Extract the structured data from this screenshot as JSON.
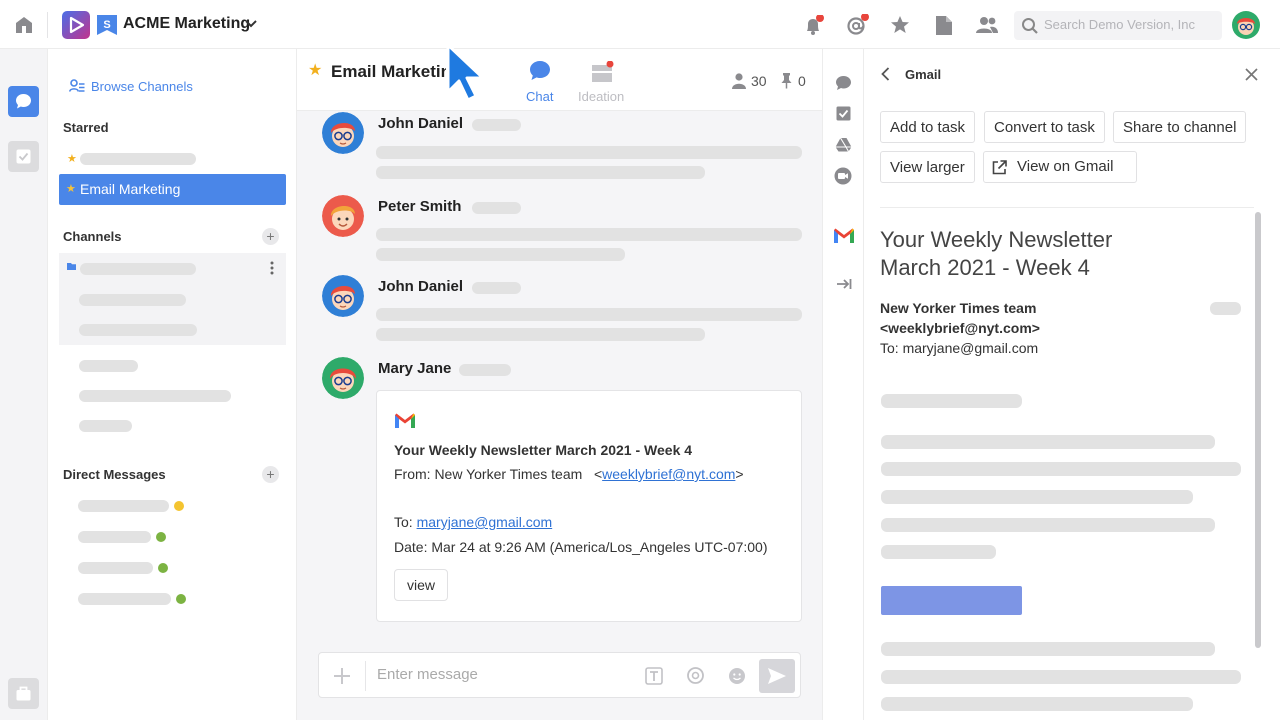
{
  "topbar": {
    "workspace_name": "ACME Marketing",
    "search_placeholder": "Search Demo Version, Inc"
  },
  "sidebar": {
    "browse_channels": "Browse Channels",
    "starred_heading": "Starred",
    "active_channel": "Email Marketing",
    "channels_heading": "Channels",
    "dm_heading": "Direct Messages"
  },
  "chat": {
    "channel_title": "Email Marketing",
    "tabs": [
      {
        "label": "Chat",
        "active": true
      },
      {
        "label": "Ideation",
        "active": false
      }
    ],
    "member_count": "30",
    "pin_count": "0",
    "messages": [
      {
        "author": "John Daniel"
      },
      {
        "author": "Peter Smith"
      },
      {
        "author": "John Daniel"
      },
      {
        "author": "Mary Jane"
      }
    ],
    "email_card": {
      "subject": "Your Weekly Newsletter March 2021 - Week 4",
      "from_label": "From: New Yorker Times team",
      "from_email": "weeklybrief@nyt.com",
      "to_label": "To:",
      "to_email": "maryjane@gmail.com",
      "date": "Date: Mar 24 at 9:26 AM (America/Los_Angeles UTC-07:00)",
      "view_label": "view"
    },
    "composer_placeholder": "Enter message"
  },
  "gmail_panel": {
    "title": "Gmail",
    "actions": [
      "Add to task",
      "Convert to task",
      "Share to channel",
      "View larger",
      "View on Gmail"
    ],
    "newsletter_title_line1": "Your Weekly Newsletter",
    "newsletter_title_line2": "March 2021 - Week 4",
    "sender_name": "New Yorker Times team",
    "sender_email": "<weeklybrief@nyt.com>",
    "recipient": "To: maryjane@gmail.com"
  },
  "colors": {
    "accent_blue": "#4a86e8",
    "notification_red": "#e8453c",
    "status_yellow": "#f4c430",
    "status_green": "#7cb342",
    "link_blue": "#2f72d4"
  }
}
